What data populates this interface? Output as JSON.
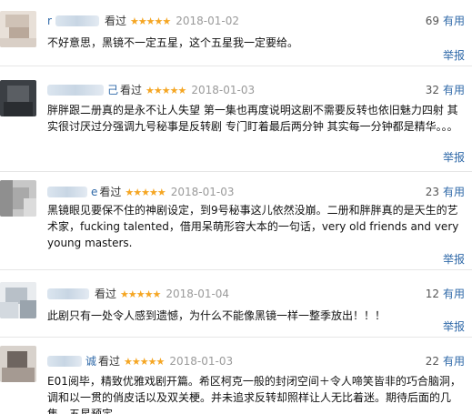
{
  "reviews": [
    {
      "user_visible": "",
      "watched": "看过",
      "stars": "★★★★★",
      "date": "2018-01-02",
      "votes": "69",
      "useful": "有用",
      "content": "不好意思，黑镜不一定五星，这个五星我一定要给。",
      "report": "举报"
    },
    {
      "user_visible": "己",
      "watched": "看过",
      "stars": "★★★★★",
      "date": "2018-01-03",
      "votes": "32",
      "useful": "有用",
      "content": "胖胖跟二册真的是永不让人失望 第一集也再度说明这剧不需要反转也依旧魅力四射 其实很讨厌过分强调九号秘事是反转剧 专门盯着最后两分钟 其实每一分钟都是精华。。。",
      "report": "举报"
    },
    {
      "user_visible": "e",
      "watched": "看过",
      "stars": "★★★★★",
      "date": "2018-01-03",
      "votes": "23",
      "useful": "有用",
      "content": "黑镜眼见要保不住的神剧设定，到9号秘事这儿依然没崩。二册和胖胖真的是天生的艺术家，fucking talented，借用呆萌形容大本的一句话，very old friends and very young masters.",
      "report": "举报"
    },
    {
      "user_visible": "",
      "watched": "看过",
      "stars": "★★★★★",
      "date": "2018-01-04",
      "votes": "12",
      "useful": "有用",
      "content": "此剧只有一处令人感到遗憾，为什么不能像黑镜一样一整季放出！！！",
      "report": "举报"
    },
    {
      "user_visible": "诚",
      "watched": "看过",
      "stars": "★★★★★",
      "date": "2018-01-03",
      "votes": "22",
      "useful": "有用",
      "content": "E01阅毕，精致优雅戏剧开篇。希区柯克一般的封闭空间＋令人啼笑皆非的巧合脑洞，调和以一贯的俏皮话以及双关梗。并未追求反转却照样让人无比着迷。期待后面的几集，五星预定。",
      "report": ""
    }
  ]
}
